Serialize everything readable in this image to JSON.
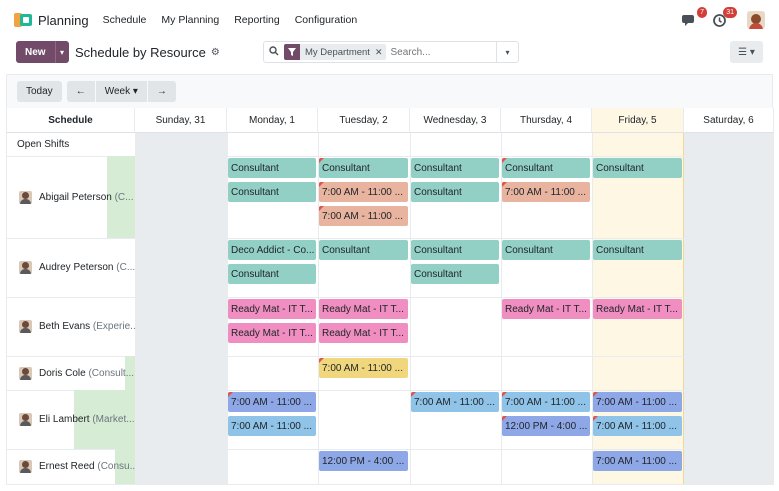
{
  "nav": {
    "app": "Planning",
    "menu": [
      "Schedule",
      "My Planning",
      "Reporting",
      "Configuration"
    ],
    "chat_badge": "7",
    "activity_badge": "31"
  },
  "control": {
    "new_label": "New",
    "title": "Schedule by Resource",
    "facet": "My Department",
    "search_placeholder": "Search..."
  },
  "toolbar": {
    "today": "Today",
    "scale": "Week ▾",
    "prev": "←",
    "next": "→"
  },
  "grid": {
    "first_header": "Schedule",
    "days": [
      "Sunday, 31",
      "Monday, 1",
      "Tuesday, 2",
      "Wednesday, 3",
      "Thursday, 4",
      "Friday, 5",
      "Saturday, 6"
    ],
    "open_shifts": "Open Shifts",
    "rows": [
      {
        "name": "Abigail Peterson",
        "role": " (C...",
        "progress": 0.22
      },
      {
        "name": "Audrey Peterson",
        "role": " (C...",
        "progress": 0
      },
      {
        "name": "Beth Evans",
        "role": " (Experie...",
        "progress": 0
      },
      {
        "name": "Doris Cole",
        "role": " (Consult...",
        "progress": 0.08
      },
      {
        "name": "Eli Lambert",
        "role": " (Market...",
        "progress": 0.48
      },
      {
        "name": "Ernest Reed",
        "role": " (Consu...",
        "progress": 0.16
      }
    ],
    "pills": [
      {
        "row": 0,
        "col": 1,
        "slot": 0,
        "text": "Consultant",
        "color": "teal",
        "warn": false
      },
      {
        "row": 0,
        "col": 2,
        "slot": 0,
        "text": "Consultant",
        "color": "teal",
        "warn": true
      },
      {
        "row": 0,
        "col": 3,
        "slot": 0,
        "text": "Consultant",
        "color": "teal",
        "warn": false
      },
      {
        "row": 0,
        "col": 4,
        "slot": 0,
        "text": "Consultant",
        "color": "teal",
        "warn": true
      },
      {
        "row": 0,
        "col": 5,
        "slot": 0,
        "text": "Consultant",
        "color": "teal",
        "warn": false
      },
      {
        "row": 0,
        "col": 1,
        "slot": 1,
        "text": "Consultant",
        "color": "teal",
        "warn": false
      },
      {
        "row": 0,
        "col": 2,
        "slot": 1,
        "text": "7:00 AM - 11:00 ...",
        "color": "salmon",
        "warn": true
      },
      {
        "row": 0,
        "col": 3,
        "slot": 1,
        "text": "Consultant",
        "color": "teal",
        "warn": false
      },
      {
        "row": 0,
        "col": 4,
        "slot": 1,
        "text": "7:00 AM - 11:00 ...",
        "color": "salmon",
        "warn": true
      },
      {
        "row": 0,
        "col": 2,
        "slot": 2,
        "text": "7:00 AM - 11:00 ...",
        "color": "salmon",
        "warn": true
      },
      {
        "row": 1,
        "col": 1,
        "slot": 0,
        "text": "Deco Addict - Co...",
        "color": "teal",
        "warn": false
      },
      {
        "row": 1,
        "col": 2,
        "slot": 0,
        "text": "Consultant",
        "color": "teal",
        "warn": false
      },
      {
        "row": 1,
        "col": 3,
        "slot": 0,
        "text": "Consultant",
        "color": "teal",
        "warn": false
      },
      {
        "row": 1,
        "col": 4,
        "slot": 0,
        "text": "Consultant",
        "color": "teal",
        "warn": false
      },
      {
        "row": 1,
        "col": 5,
        "slot": 0,
        "text": "Consultant",
        "color": "teal",
        "warn": false
      },
      {
        "row": 1,
        "col": 1,
        "slot": 1,
        "text": "Consultant",
        "color": "teal",
        "warn": false
      },
      {
        "row": 1,
        "col": 3,
        "slot": 1,
        "text": "Consultant",
        "color": "teal",
        "warn": false
      },
      {
        "row": 2,
        "col": 1,
        "slot": 0,
        "text": "Ready Mat - IT T...",
        "color": "pink",
        "warn": false
      },
      {
        "row": 2,
        "col": 2,
        "slot": 0,
        "text": "Ready Mat - IT T...",
        "color": "pink",
        "warn": false
      },
      {
        "row": 2,
        "col": 4,
        "slot": 0,
        "text": "Ready Mat - IT T...",
        "color": "pink",
        "warn": false
      },
      {
        "row": 2,
        "col": 5,
        "slot": 0,
        "text": "Ready Mat - IT T...",
        "color": "pink",
        "warn": false
      },
      {
        "row": 2,
        "col": 1,
        "slot": 1,
        "text": "Ready Mat - IT T...",
        "color": "pink",
        "warn": false
      },
      {
        "row": 2,
        "col": 2,
        "slot": 1,
        "text": "Ready Mat - IT T...",
        "color": "pink",
        "warn": false
      },
      {
        "row": 3,
        "col": 2,
        "slot": 0,
        "text": "7:00 AM - 11:00 ...",
        "color": "yellow",
        "warn": true
      },
      {
        "row": 4,
        "col": 1,
        "slot": 0,
        "text": "7:00 AM - 11:00 ...",
        "color": "blue",
        "warn": true
      },
      {
        "row": 4,
        "col": 3,
        "slot": 0,
        "text": "7:00 AM - 11:00 ...",
        "color": "lblue",
        "warn": true
      },
      {
        "row": 4,
        "col": 4,
        "slot": 0,
        "text": "7:00 AM - 11:00 ...",
        "color": "lblue",
        "warn": true
      },
      {
        "row": 4,
        "col": 5,
        "slot": 0,
        "text": "7:00 AM - 11:00 ...",
        "color": "blue",
        "warn": true
      },
      {
        "row": 4,
        "col": 1,
        "slot": 1,
        "text": "7:00 AM - 11:00 ...",
        "color": "lblue",
        "warn": false
      },
      {
        "row": 4,
        "col": 4,
        "slot": 1,
        "text": "12:00 PM - 4:00 ...",
        "color": "blue",
        "warn": true
      },
      {
        "row": 4,
        "col": 5,
        "slot": 1,
        "text": "7:00 AM - 11:00 ...",
        "color": "lblue",
        "warn": true
      },
      {
        "row": 5,
        "col": 2,
        "slot": 0,
        "text": "12:00 PM - 4:00 ...",
        "color": "blue",
        "warn": false
      },
      {
        "row": 5,
        "col": 5,
        "slot": 0,
        "text": "7:00 AM - 11:00 ...",
        "color": "blue",
        "warn": false
      }
    ]
  },
  "colors": {
    "primary": "#714b67",
    "today": "#fdf7e3",
    "today_border": "#efd99a",
    "weekend": "#e9ecef"
  }
}
